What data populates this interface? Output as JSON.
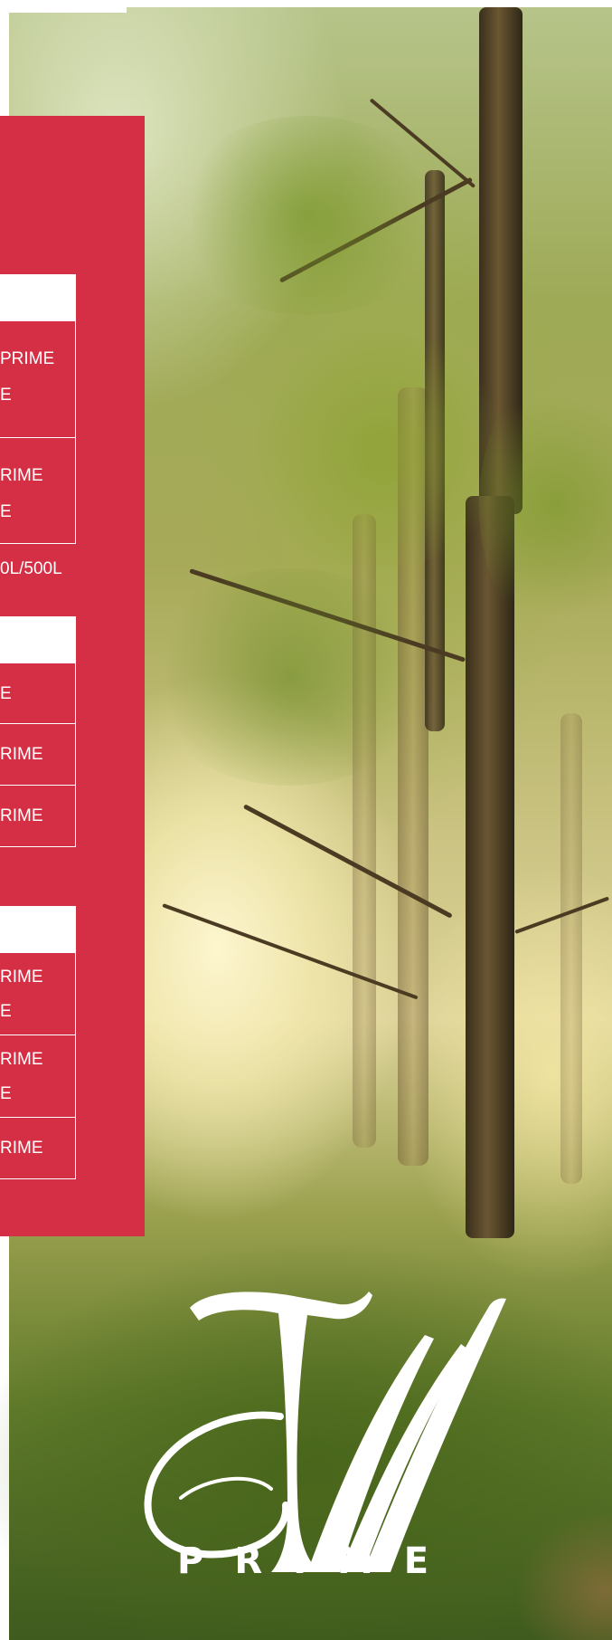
{
  "tables": [
    {
      "id": "table-1",
      "rows": [
        [
          "PRIME",
          "E"
        ],
        [
          "RIME",
          "E"
        ]
      ]
    },
    {
      "id": "table-2",
      "rows": [
        [
          "E"
        ],
        [
          "RIME"
        ],
        [
          "RIME"
        ]
      ]
    },
    {
      "id": "table-3",
      "rows": [
        [
          "RIME",
          "E"
        ],
        [
          "RIME",
          "E"
        ],
        [
          "RIME"
        ]
      ]
    }
  ],
  "volume_text": "0L/500L",
  "brand": {
    "monogram": "TM",
    "wordmark": "PRIME"
  },
  "colors": {
    "panel_red": "#d42f45",
    "text_white": "#ffffff"
  }
}
